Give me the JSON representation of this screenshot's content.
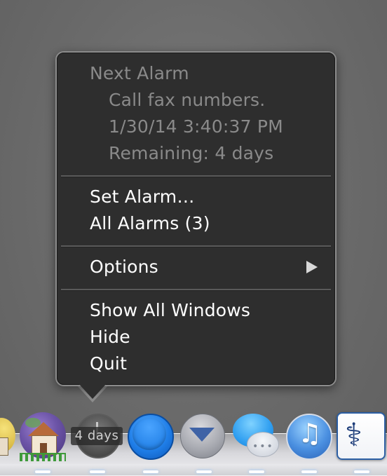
{
  "menu": {
    "next_alarm": {
      "title": "Next Alarm",
      "message": "Call fax numbers.",
      "datetime": "1/30/14 3:40:37 PM",
      "remaining": "Remaining: 4 days"
    },
    "set_alarm": "Set Alarm…",
    "all_alarms": "All Alarms (3)",
    "options": "Options",
    "show_all_windows": "Show All Windows",
    "hide": "Hide",
    "quit": "Quit"
  },
  "dock": {
    "badge": "4 days",
    "icons": [
      "yellow-app-icon",
      "globe-house-icon",
      "alarm-clock-app-icon",
      "blue-circle-app-icon",
      "gray-chevron-app-icon",
      "messages-icon",
      "itunes-icon",
      "medical-caduceus-icon"
    ],
    "itunes_glyph": "♫",
    "medical_glyph": "⚕",
    "messages_glyph": "•••"
  },
  "colors": {
    "menu_background": "#2e2e2e",
    "menu_border": "#8c8c8c",
    "enabled_text": "#ffffff",
    "disabled_text": "#8a8a8a"
  }
}
